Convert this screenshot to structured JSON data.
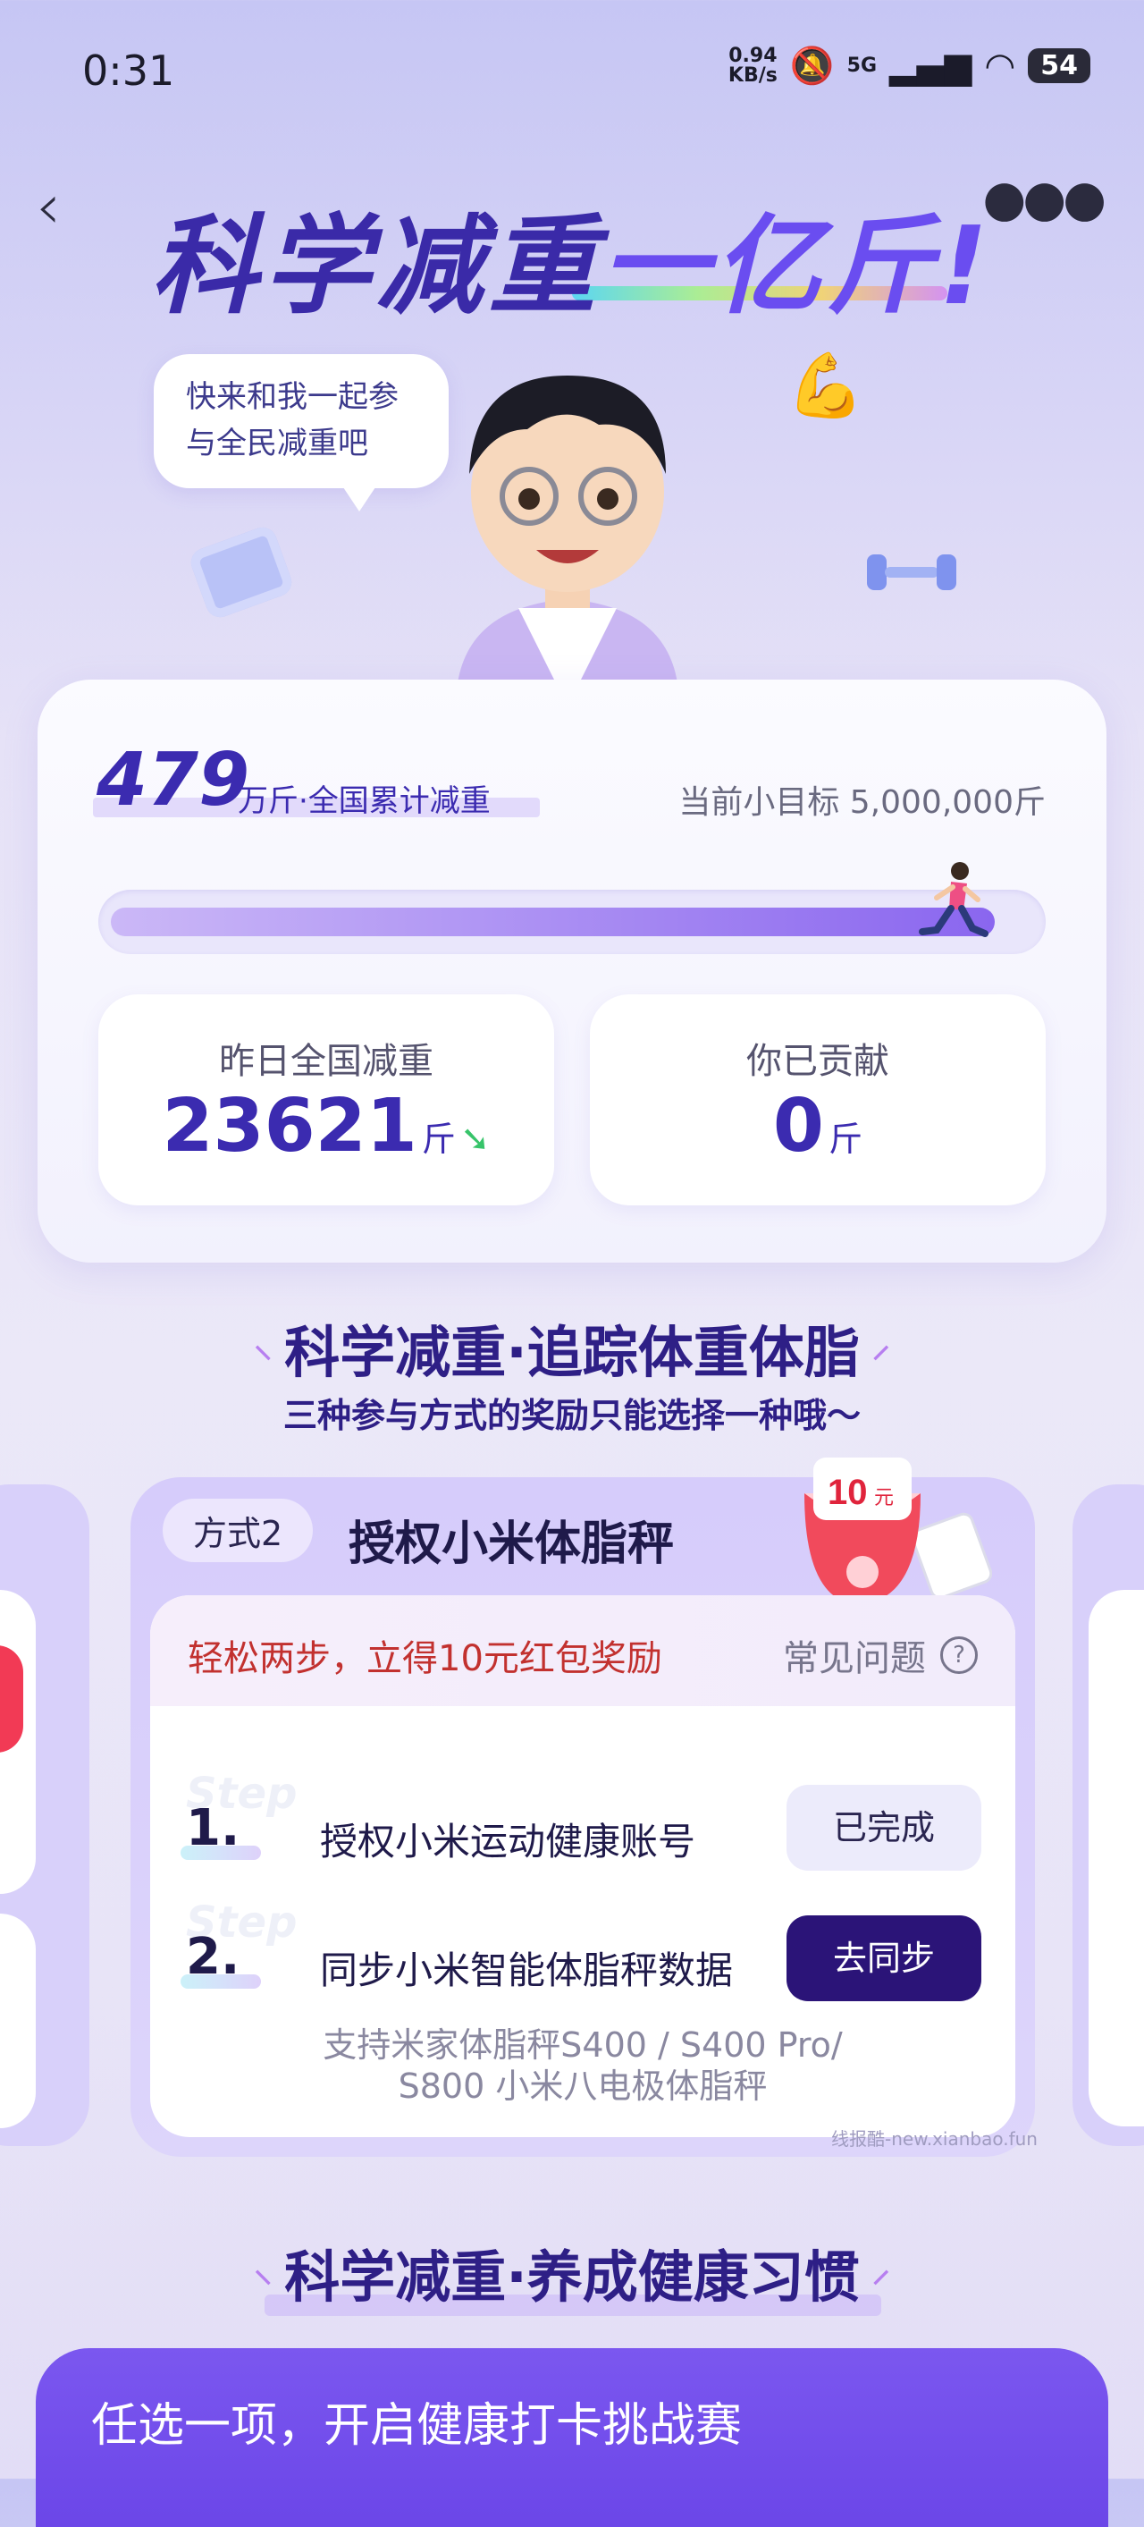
{
  "status": {
    "time": "0:31",
    "net_speed_value": "0.94",
    "net_speed_unit": "KB/s",
    "network": "5G",
    "battery": "54"
  },
  "header": {
    "title_main": "科学减重",
    "title_highlight": "一亿斤!",
    "speech": "快来和我一起参与全民减重吧"
  },
  "stats": {
    "total_value": "479",
    "total_label": "万斤·全国累计减重",
    "goal_label": "当前小目标 5,000,000斤",
    "progress_fraction": 0.958,
    "yesterday_label": "昨日全国减重",
    "yesterday_value": "23621",
    "yesterday_unit": "斤",
    "contributed_label": "你已贡献",
    "contributed_value": "0",
    "contributed_unit": "斤"
  },
  "section1": {
    "title": "科学减重·追踪体重体脂",
    "subtitle": "三种参与方式的奖励只能选择一种哦～"
  },
  "option": {
    "tag": "方式2",
    "title": "授权小米体脂秤",
    "reward_amount": "10",
    "reward_unit": "元",
    "promo": "轻松两步，立得10元红包奖励",
    "faq": "常见问题",
    "steps": [
      {
        "num": "1.",
        "ghost": "Step",
        "text": "授权小米运动健康账号",
        "button": "已完成"
      },
      {
        "num": "2.",
        "ghost": "Step",
        "text": "同步小米智能体脂秤数据",
        "button": "去同步"
      }
    ],
    "support_line1": "支持米家体脂秤S400 / S400 Pro/",
    "support_line2": "S800 小米八电极体脂秤"
  },
  "watermark": "线报酷-new.xianbao.fun",
  "section2": {
    "title": "科学减重·养成健康习惯"
  },
  "challenge": {
    "text": "任选一项，开启健康打卡挑战赛"
  },
  "icons": {
    "back": "chevron-left-icon",
    "more": "more-dots-icon",
    "question": "question-circle-icon",
    "trend": "down-arrow-icon"
  }
}
